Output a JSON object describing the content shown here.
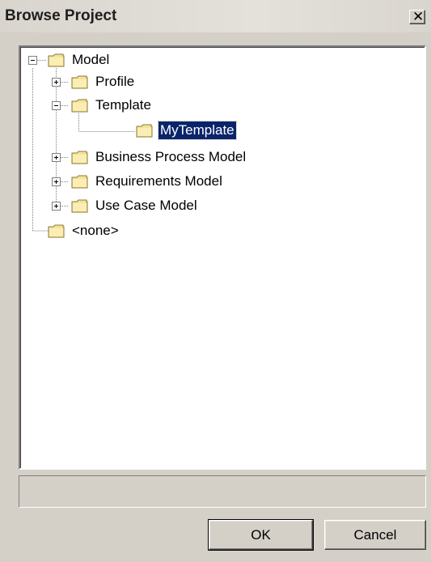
{
  "window": {
    "title": "Browse Project"
  },
  "tree": {
    "root": "Model",
    "children": [
      {
        "label": "Profile",
        "expanded": false
      },
      {
        "label": "Template",
        "expanded": true,
        "children": [
          {
            "label": "MyTemplate",
            "selected": true
          }
        ]
      },
      {
        "label": "Business Process Model",
        "expanded": false
      },
      {
        "label": "Requirements Model",
        "expanded": false
      },
      {
        "label": "Use Case Model",
        "expanded": false
      }
    ],
    "none": "<none>"
  },
  "status": {
    "text": ""
  },
  "buttons": {
    "ok": "OK",
    "cancel": "Cancel"
  },
  "colors": {
    "selection": "#0a246a",
    "dialog_bg": "#d4d0c8",
    "folder": "#f6e39a"
  }
}
